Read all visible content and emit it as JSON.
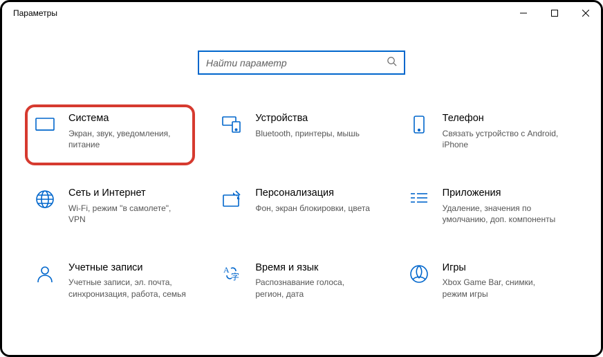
{
  "window": {
    "title": "Параметры"
  },
  "search": {
    "placeholder": "Найти параметр"
  },
  "tiles": {
    "system": {
      "title": "Система",
      "desc": "Экран, звук, уведомления, питание"
    },
    "devices": {
      "title": "Устройства",
      "desc": "Bluetooth, принтеры, мышь"
    },
    "phone": {
      "title": "Телефон",
      "desc": "Связать устройство с Android, iPhone"
    },
    "network": {
      "title": "Сеть и Интернет",
      "desc": "Wi-Fi, режим \"в самолете\", VPN"
    },
    "personalize": {
      "title": "Персонализация",
      "desc": "Фон, экран блокировки, цвета"
    },
    "apps": {
      "title": "Приложения",
      "desc": "Удаление, значения по умолчанию, доп. компоненты"
    },
    "accounts": {
      "title": "Учетные записи",
      "desc": "Учетные записи, эл. почта, синхронизация, работа, семья"
    },
    "time": {
      "title": "Время и язык",
      "desc": "Распознавание голоса, регион, дата"
    },
    "gaming": {
      "title": "Игры",
      "desc": "Xbox Game Bar, снимки, режим игры"
    }
  },
  "colors": {
    "accent": "#0066CC",
    "highlight": "#D63A2F"
  }
}
